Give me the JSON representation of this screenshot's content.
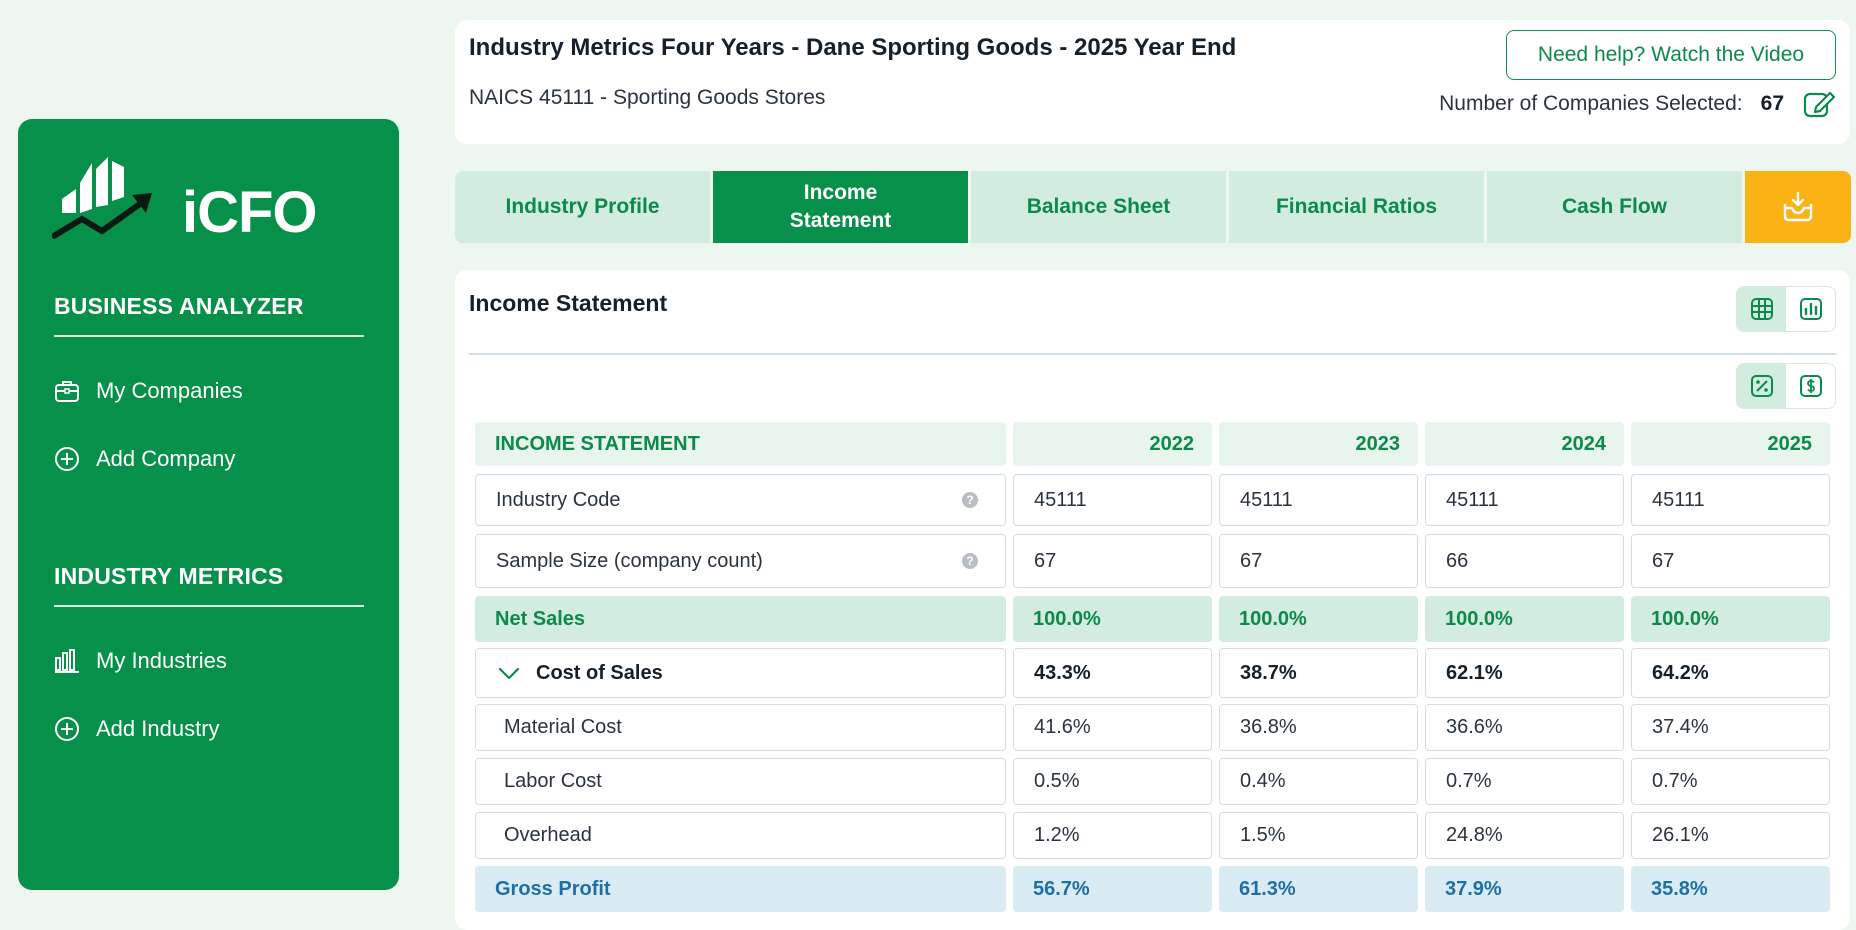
{
  "sidebar": {
    "logo_text": "iCFO",
    "sections": [
      {
        "title": "BUSINESS ANALYZER",
        "items": [
          {
            "label": "My Companies",
            "icon": "briefcase-icon"
          },
          {
            "label": "Add Company",
            "icon": "plus-circle-icon"
          }
        ]
      },
      {
        "title": "INDUSTRY METRICS",
        "items": [
          {
            "label": "My Industries",
            "icon": "bar-chart-icon"
          },
          {
            "label": "Add Industry",
            "icon": "plus-circle-icon"
          }
        ]
      }
    ]
  },
  "header": {
    "title": "Industry Metrics Four Years - Dane Sporting Goods - 2025 Year End",
    "subtitle": "NAICS 45111 - Sporting Goods Stores",
    "help_button": "Need help? Watch the Video",
    "count_label": "Number of Companies Selected:",
    "count_value": "67"
  },
  "tabs": [
    {
      "label": "Industry Profile",
      "active": false
    },
    {
      "label": "Income Statement",
      "active": true
    },
    {
      "label": "Balance Sheet",
      "active": false
    },
    {
      "label": "Financial Ratios",
      "active": false
    },
    {
      "label": "Cash Flow",
      "active": false
    }
  ],
  "main": {
    "title": "Income Statement",
    "table": {
      "header": [
        "INCOME STATEMENT",
        "2022",
        "2023",
        "2024",
        "2025"
      ],
      "rows": [
        {
          "label": "Industry Code",
          "values": [
            "45111",
            "45111",
            "45111",
            "45111"
          ]
        },
        {
          "label": "Sample Size (company count)",
          "values": [
            "67",
            "67",
            "66",
            "67"
          ]
        },
        {
          "label": "Net Sales",
          "values": [
            "100.0%",
            "100.0%",
            "100.0%",
            "100.0%"
          ]
        },
        {
          "label": "Cost of Sales",
          "values": [
            "43.3%",
            "38.7%",
            "62.1%",
            "64.2%"
          ]
        },
        {
          "label": "Material Cost",
          "values": [
            "41.6%",
            "36.8%",
            "36.6%",
            "37.4%"
          ]
        },
        {
          "label": "Labor Cost",
          "values": [
            "0.5%",
            "0.4%",
            "0.7%",
            "0.7%"
          ]
        },
        {
          "label": "Overhead",
          "values": [
            "1.2%",
            "1.5%",
            "24.8%",
            "26.1%"
          ]
        },
        {
          "label": "Gross Profit",
          "values": [
            "56.7%",
            "61.3%",
            "37.9%",
            "35.8%"
          ]
        }
      ]
    }
  },
  "colors": {
    "brand_green": "#07904a",
    "tab_light": "#d3ece0",
    "download_yellow": "#fbb214",
    "gross_blue": "#1e6fa8"
  }
}
